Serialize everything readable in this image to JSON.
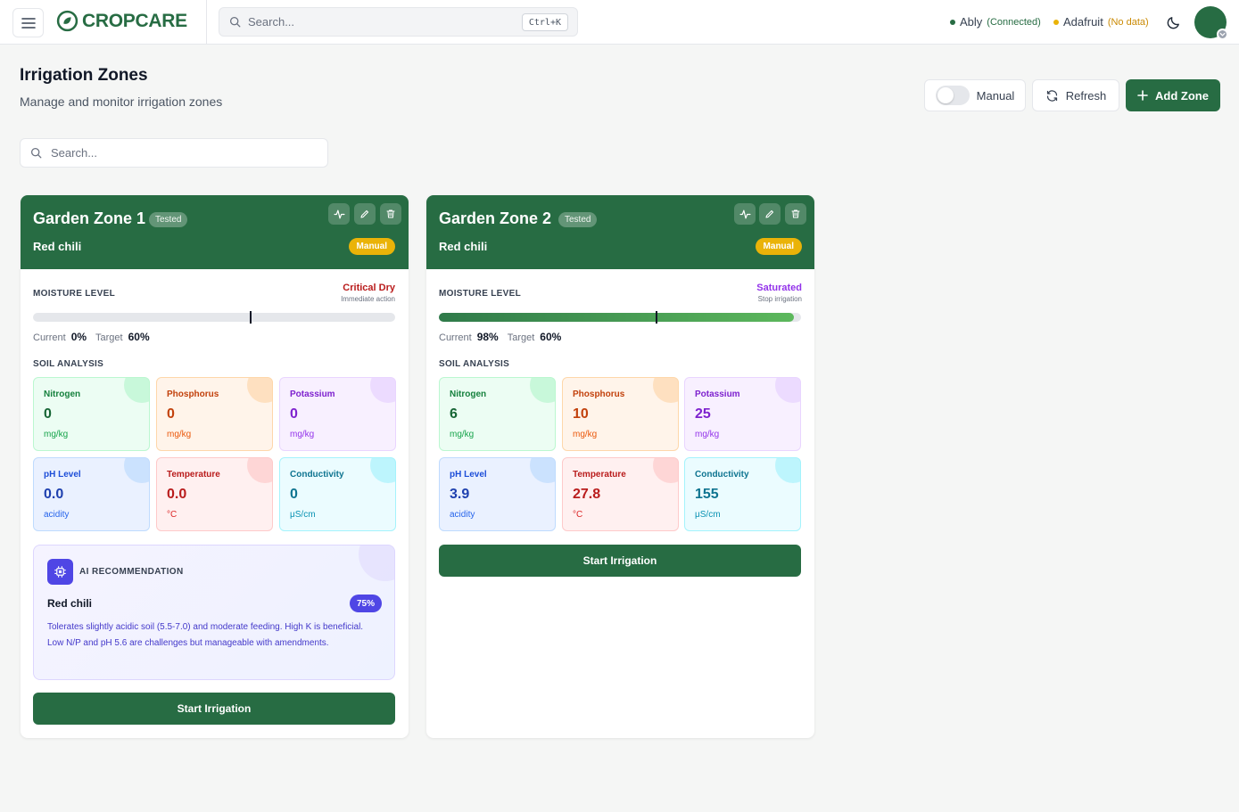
{
  "app": {
    "brand": "CROPCARE"
  },
  "topbar": {
    "search_placeholder": "Search...",
    "shortcut": "Ctrl+K",
    "ably_label": "Ably",
    "ably_status": "(Connected)",
    "adafruit_label": "Adafruit",
    "adafruit_status": "(No data)"
  },
  "colors": {
    "primary": "#276c43",
    "ably": "#276c43",
    "adafruit": "#eab308",
    "critical": "#b91c1c",
    "saturated": "#9333ea",
    "ai": "#4f46e5"
  },
  "header": {
    "title": "Irrigation Zones",
    "subtitle": "Manage and monitor irrigation zones",
    "manual_label": "Manual",
    "refresh_label": "Refresh",
    "add_zone_label": "Add Zone",
    "search_placeholder": "Search..."
  },
  "zones": [
    {
      "name": "Garden Zone 1",
      "tested": "Tested",
      "crop": "Red chili",
      "mode": "Manual",
      "moisture_label": "MOISTURE LEVEL",
      "moisture_status": "Critical Dry",
      "moisture_hint": "Immediate action",
      "current_label": "Current",
      "current": "0%",
      "current_fraction": 0,
      "target_label": "Target",
      "target": "60%",
      "target_fraction": 0.6,
      "soil_label": "SOIL ANALYSIS",
      "soil": {
        "nitrogen": {
          "name": "Nitrogen",
          "value": "0",
          "unit": "mg/kg"
        },
        "phosphorus": {
          "name": "Phosphorus",
          "value": "0",
          "unit": "mg/kg"
        },
        "potassium": {
          "name": "Potassium",
          "value": "0",
          "unit": "mg/kg"
        },
        "ph": {
          "name": "pH Level",
          "value": "0.0",
          "unit": "acidity"
        },
        "temperature": {
          "name": "Temperature",
          "value": "0.0",
          "unit": "°C"
        },
        "conductivity": {
          "name": "Conductivity",
          "value": "0",
          "unit": "μS/cm"
        }
      },
      "ai": {
        "title": "AI RECOMMENDATION",
        "crop": "Red chili",
        "confidence": "75%",
        "text": "Tolerates slightly acidic soil (5.5-7.0) and moderate feeding. High K is beneficial. Low N/P and pH 5.6 are challenges but manageable with amendments."
      },
      "start_label": "Start Irrigation"
    },
    {
      "name": "Garden Zone 2",
      "tested": "Tested",
      "crop": "Red chili",
      "mode": "Manual",
      "moisture_label": "MOISTURE LEVEL",
      "moisture_status": "Saturated",
      "moisture_hint": "Stop irrigation",
      "current_label": "Current",
      "current": "98%",
      "current_fraction": 0.98,
      "target_label": "Target",
      "target": "60%",
      "target_fraction": 0.6,
      "soil_label": "SOIL ANALYSIS",
      "soil": {
        "nitrogen": {
          "name": "Nitrogen",
          "value": "6",
          "unit": "mg/kg"
        },
        "phosphorus": {
          "name": "Phosphorus",
          "value": "10",
          "unit": "mg/kg"
        },
        "potassium": {
          "name": "Potassium",
          "value": "25",
          "unit": "mg/kg"
        },
        "ph": {
          "name": "pH Level",
          "value": "3.9",
          "unit": "acidity"
        },
        "temperature": {
          "name": "Temperature",
          "value": "27.8",
          "unit": "°C"
        },
        "conductivity": {
          "name": "Conductivity",
          "value": "155",
          "unit": "μS/cm"
        }
      },
      "start_label": "Start Irrigation"
    }
  ]
}
